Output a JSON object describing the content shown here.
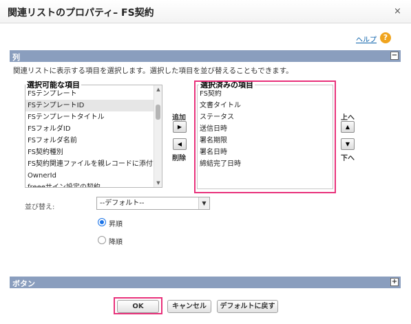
{
  "dialog": {
    "title": "関連リストのプロパティ– FS契約",
    "close_glyph": "×",
    "help_label": "ヘルプ",
    "help_glyph": "?"
  },
  "columns_section": {
    "title": "列",
    "toggle_glyph": "−",
    "description": "関連リストに表示する項目を選択します。選択した項目を並び替えることもできます。"
  },
  "available": {
    "label": "選択可能な項目",
    "items": [
      "FSテンプレート",
      "FSテンプレートID",
      "FSテンプレートタイトル",
      "FSフォルダID",
      "FSフォルダ名前",
      "FS契約種別",
      "FS契約関連ファイルを親レコードに添付す",
      "OwnerId",
      "freeeサイン設定の契約"
    ],
    "selected_index": 1
  },
  "transfer": {
    "add_label": "追加",
    "add_glyph": "▶",
    "remove_glyph": "◀",
    "remove_label": "削除"
  },
  "selected": {
    "label": "選択済みの項目",
    "items": [
      "FS契約",
      "文書タイトル",
      "ステータス",
      "送信日時",
      "署名期限",
      "署名日時",
      "締結完了日時"
    ]
  },
  "order": {
    "up_label": "上へ",
    "up_glyph": "▲",
    "down_glyph": "▼",
    "down_label": "下へ"
  },
  "sort": {
    "label": "並び替え:",
    "value": "--デフォルト--",
    "arrow_glyph": "▼",
    "ascending_label": "昇順",
    "descending_label": "降順",
    "ascending_checked": true
  },
  "buttons_section": {
    "title": "ボタン",
    "toggle_glyph": "+"
  },
  "footer": {
    "ok_label": "OK",
    "cancel_label": "キャンセル",
    "reset_label": "デフォルトに戻す"
  },
  "colors": {
    "section_bar": "#8a9ebe",
    "highlight": "#e8307a",
    "help_icon": "#f0a41e",
    "link": "#015ba7",
    "radio_selected": "#1a73e8"
  }
}
